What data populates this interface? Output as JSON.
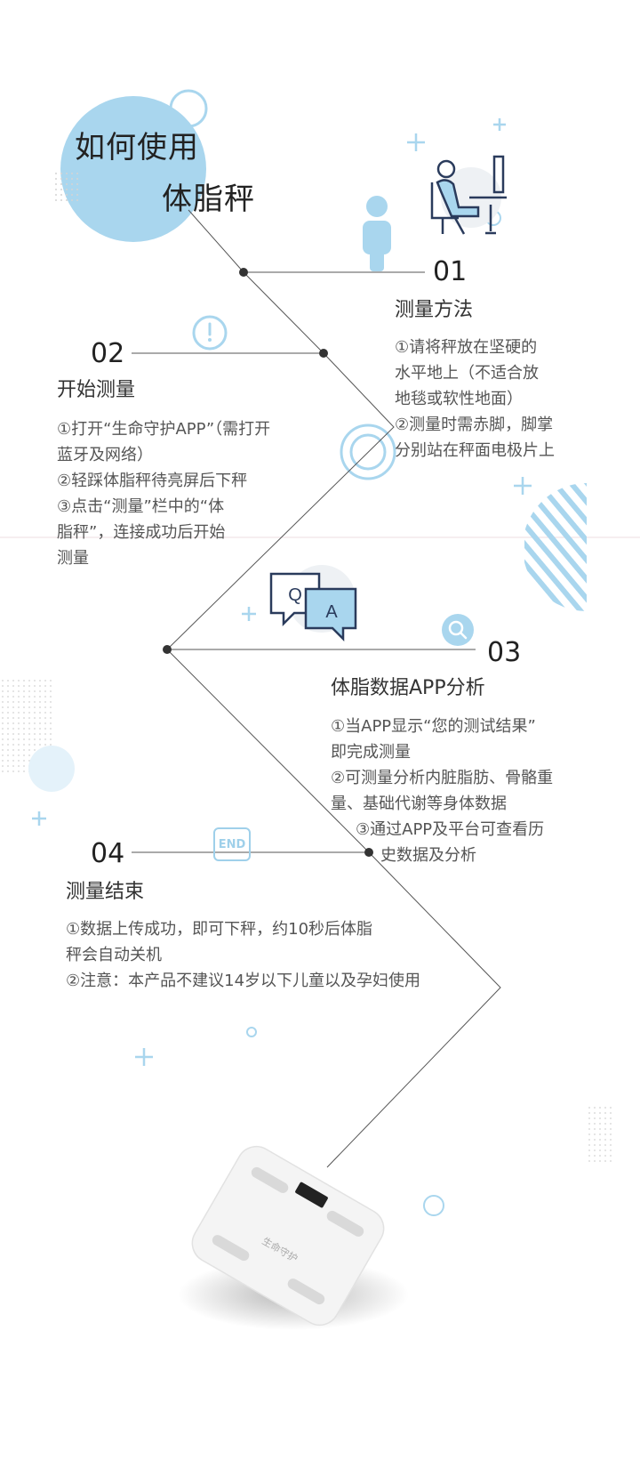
{
  "title": {
    "line1": "如何使用",
    "line2": "体脂秤"
  },
  "steps": [
    {
      "num": "01",
      "heading": "测量方法",
      "lines": [
        "①请将秤放在坚硬的",
        "水平地上（不适合放",
        "地毯或软性地面）",
        "②测量时需赤脚，脚掌",
        "分别站在秤面电极片上"
      ]
    },
    {
      "num": "02",
      "heading": "开始测量",
      "lines": [
        "①打开“生命守护APP”（需打开",
        "蓝牙及网络）",
        "②轻踩体脂秤待亮屏后下秤",
        "③点击“测量”栏中的“体",
        "脂秤”，连接成功后开始",
        "测量"
      ]
    },
    {
      "num": "03",
      "heading": "体脂数据APP分析",
      "lines": [
        "①当APP显示“您的测试结果”",
        "即完成测量",
        "②可测量分析内脏脂肪、骨骼重",
        "量、基础代谢等身体数据",
        "③通过APP及平台可查看历",
        "史数据及分析"
      ]
    },
    {
      "num": "04",
      "heading": "测量结束",
      "lines": [
        "①数据上传成功，即可下秤，约10秒后体脂",
        "秤会自动关机",
        "②注意：本产品不建议14岁以下儿童以及孕妇使用"
      ]
    }
  ],
  "icons": {
    "qa_q": "Q",
    "qa_a": "A",
    "end_badge": "END",
    "scale_brand": "生命守护"
  },
  "colors": {
    "accent": "#a9d6ee",
    "line": "#555555",
    "text": "#333333"
  }
}
